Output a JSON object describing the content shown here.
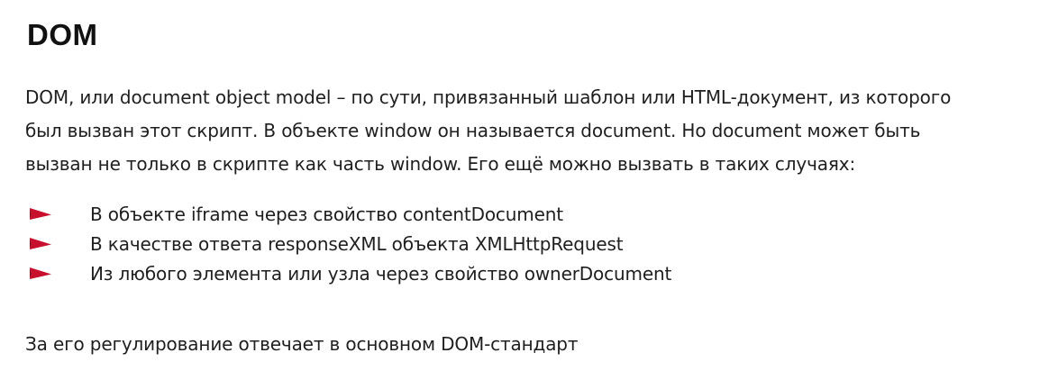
{
  "title": "DOM",
  "intro_lines": [
    "DOM, или document object model – по сути, привязанный шаблон или HTML-документ, из которого",
    "был вызван этот скрипт. В объекте window он называется document. Но document может быть",
    "вызван не только в скрипте как часть window. Его ещё можно вызвать в таких случаях:"
  ],
  "bullets": [
    "В объекте iframe через свойство contentDocument",
    "В качестве ответа responseXML объекта XMLHttpRequest",
    "Из любого элемента или узла через свойство ownerDocument"
  ],
  "bullet_icon": "red-flag-icon",
  "accent_color": "#c8102e",
  "footer": "За его регулирование отвечает в основном DOM-стандарт"
}
